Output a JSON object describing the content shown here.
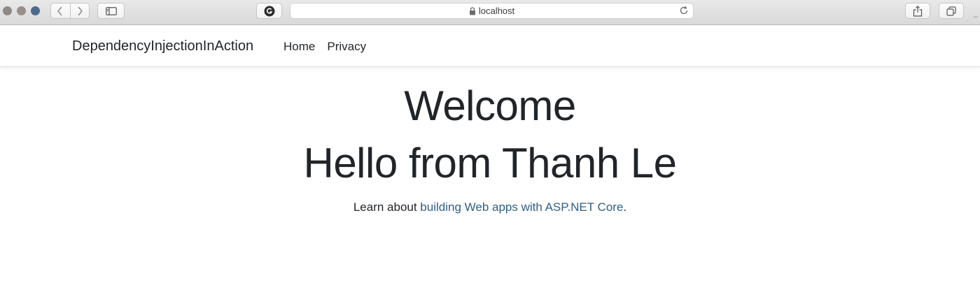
{
  "browser": {
    "url": "localhost",
    "icons": {
      "back": "chevron-left-icon",
      "forward": "chevron-right-icon",
      "sidebar": "sidebar-icon",
      "extension": "grammarly-icon",
      "lock": "lock-icon",
      "reload": "reload-icon",
      "share": "share-icon",
      "tabs": "tabs-overview-icon"
    }
  },
  "navbar": {
    "brand": "DependencyInjectionInAction",
    "links": [
      {
        "label": "Home"
      },
      {
        "label": "Privacy"
      }
    ]
  },
  "main": {
    "heading": "Welcome",
    "subheading": "Hello from Thanh Le",
    "learn_prefix": "Learn about ",
    "learn_link": "building Web apps with ASP.NET Core",
    "learn_suffix": "."
  },
  "colors": {
    "link": "#2f5e86",
    "text": "#212529",
    "toolbar": "#dedede"
  }
}
